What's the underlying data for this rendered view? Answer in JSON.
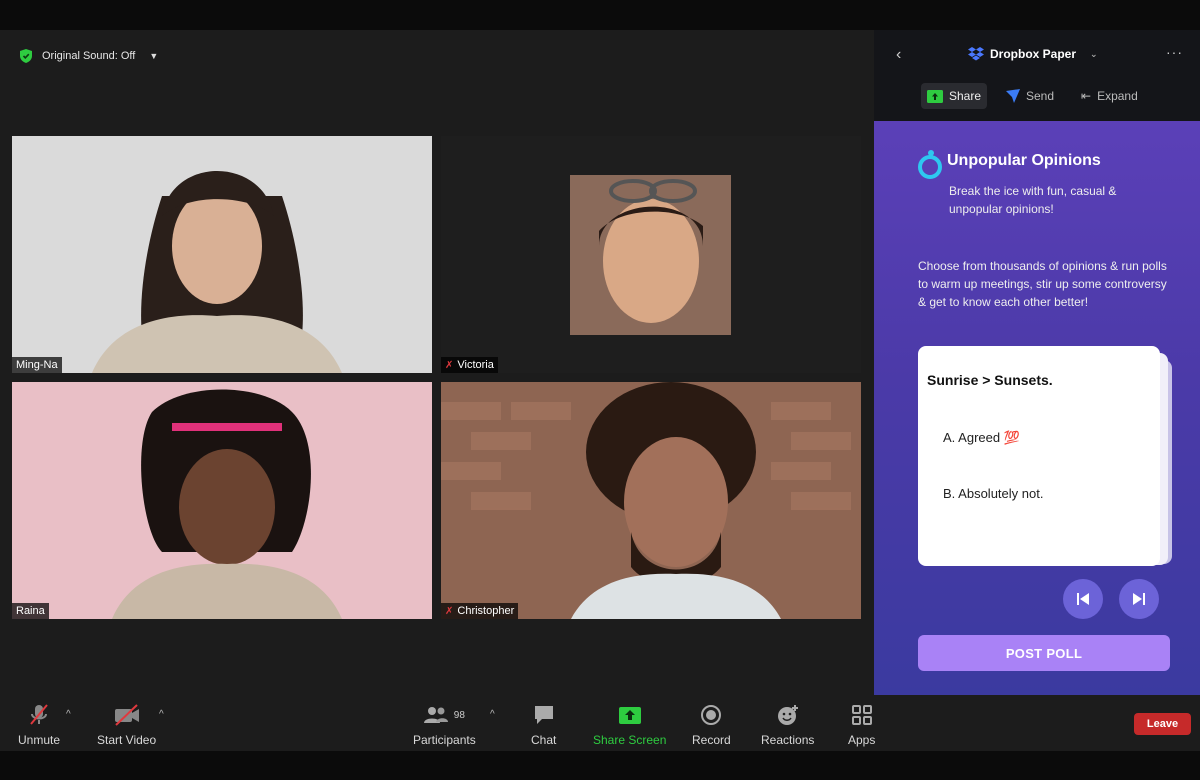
{
  "header": {
    "sound_label": "Original Sound: Off"
  },
  "participants": [
    {
      "name": "Ming-Na",
      "muted": false,
      "bg": "#d7d7d7"
    },
    {
      "name": "Victoria",
      "muted": true,
      "bg": "#1e1e1e"
    },
    {
      "name": "Raina",
      "muted": false,
      "bg": "#e8bcc4"
    },
    {
      "name": "Christopher",
      "muted": true,
      "bg": "#9a6b55"
    }
  ],
  "toolbar": {
    "unmute": "Unmute",
    "start_video": "Start Video",
    "participants": "Participants",
    "participants_count": "98",
    "chat": "Chat",
    "share_screen": "Share Screen",
    "record": "Record",
    "reactions": "Reactions",
    "apps": "Apps",
    "leave": "Leave"
  },
  "panel": {
    "app_name": "Dropbox Paper",
    "actions": {
      "share": "Share",
      "send": "Send",
      "expand": "Expand"
    },
    "title": "Unpopular Opinions",
    "subtitle": "Break the ice with fun, casual & unpopular opinions!",
    "description": "Choose from thousands of opinions & run polls to warm up meetings, stir up some controversy & get to know each other better!",
    "card": {
      "question": "Sunrise > Sunsets.",
      "option_a": "A. Agreed 💯",
      "option_b": "B. Absolutely not."
    },
    "post_poll": "POST POLL"
  },
  "colors": {
    "accent_green": "#2ecc40",
    "leave_red": "#c62a2a",
    "panel_purple": "#5b40b8",
    "post_poll": "#a982f6"
  }
}
